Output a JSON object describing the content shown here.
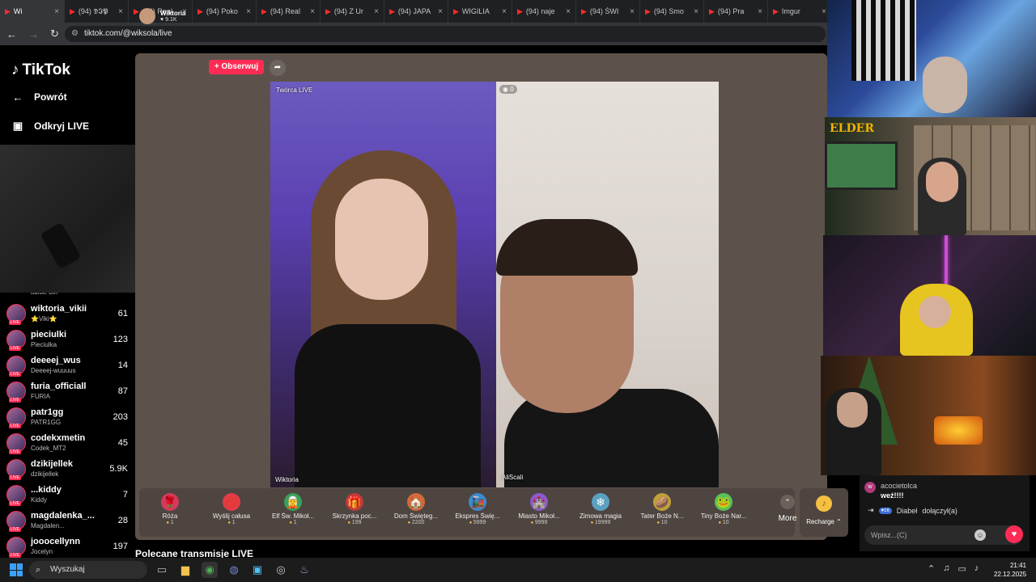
{
  "browser": {
    "tabs": [
      {
        "label": "Wi",
        "active": true
      },
      {
        "label": "(94) 𝕯𝕴𝕻"
      },
      {
        "label": "(94) Real"
      },
      {
        "label": "(94) Poko"
      },
      {
        "label": "(94) Real"
      },
      {
        "label": "(94) Z Ur"
      },
      {
        "label": "(94) JAPA"
      },
      {
        "label": "WIGILIA"
      },
      {
        "label": "(94) naje"
      },
      {
        "label": "(94) ŚWI"
      },
      {
        "label": "(94) Smo"
      },
      {
        "label": "(94) Pra"
      },
      {
        "label": "Imgur"
      }
    ],
    "url": "tiktok.com/@wiksola/live"
  },
  "sidebar": {
    "logo": "TikTok",
    "back_label": "Powrót",
    "discover_label": "Odkryj LIVE",
    "partial_item": "Barbie Girl",
    "users": [
      {
        "name": "wiktoria_vikii",
        "sub": "⭐Viki⭐",
        "count": "61"
      },
      {
        "name": "pieciulki",
        "sub": "Pieciulka",
        "count": "123"
      },
      {
        "name": "deeeej_wus",
        "sub": "Deeeej-wuuuus",
        "count": "14"
      },
      {
        "name": "furia_officiall",
        "sub": "FURIA",
        "count": "87"
      },
      {
        "name": "patr1gg",
        "sub": "PATR1GG",
        "count": "203"
      },
      {
        "name": "codekxmetin",
        "sub": "Codek_MT2",
        "count": "45"
      },
      {
        "name": "dzikijellek",
        "sub": "dzikijellek",
        "count": "5.9K"
      },
      {
        "name": "...kiddy",
        "sub": "Kiddy",
        "count": "7"
      },
      {
        "name": "magdalenka_...",
        "sub": "Magdalen...",
        "count": "28"
      },
      {
        "name": "jooocellynn",
        "sub": "Jocelyn",
        "count": "197"
      }
    ],
    "live_badge": "LIVE"
  },
  "stream": {
    "host_name": "Wiktoria",
    "host_likes": "9.1K",
    "follow_label": "+ Obserwuj",
    "creator_tag": "Twórca LIVE",
    "viewers": "0",
    "left_name": "Wiktoria",
    "right_name": "AliScali"
  },
  "gifts": [
    {
      "name": "Róża",
      "price": "1",
      "icon": "🌹",
      "color": "#d43a5a"
    },
    {
      "name": "Wyślij całusa",
      "price": "1",
      "icon": "💋",
      "color": "#e23b4a"
    },
    {
      "name": "Elf Św. Mikoł...",
      "price": "1",
      "icon": "🧝",
      "color": "#3aa05a"
    },
    {
      "name": "Skrzynka poc...",
      "price": "199",
      "icon": "🎁",
      "color": "#c23a3a"
    },
    {
      "name": "Dom Święteg...",
      "price": "2200",
      "icon": "🏠",
      "color": "#d06a3a"
    },
    {
      "name": "Ekspres Świę...",
      "price": "5999",
      "icon": "🚂",
      "color": "#3a8ad0"
    },
    {
      "name": "Miasto Mikoł...",
      "price": "9999",
      "icon": "🏰",
      "color": "#8a5ad0"
    },
    {
      "name": "Zimowa magia",
      "price": "19999",
      "icon": "❄",
      "color": "#5aa0c0"
    },
    {
      "name": "Tater Boże N...",
      "price": "10",
      "icon": "🥔",
      "color": "#c0a03a"
    },
    {
      "name": "Tiny Boże Nar...",
      "price": "10",
      "icon": "🐸",
      "color": "#5ac05a"
    }
  ],
  "more_label": "More",
  "recharge_label": "Recharge",
  "recommended_title": "Polecane transmisje LIVE",
  "overlay": {
    "elder_text": "ELDER"
  },
  "chat": {
    "msg_user": "acocietolca",
    "msg_text": "weź!!!!",
    "join_level": "16",
    "join_user": "Diabeł",
    "join_text": "dołączył(a)",
    "input_placeholder": "Wpisz...(C)"
  },
  "taskbar": {
    "search_placeholder": "Wyszukaj",
    "time": "21:41",
    "date": "22.12.2025"
  }
}
